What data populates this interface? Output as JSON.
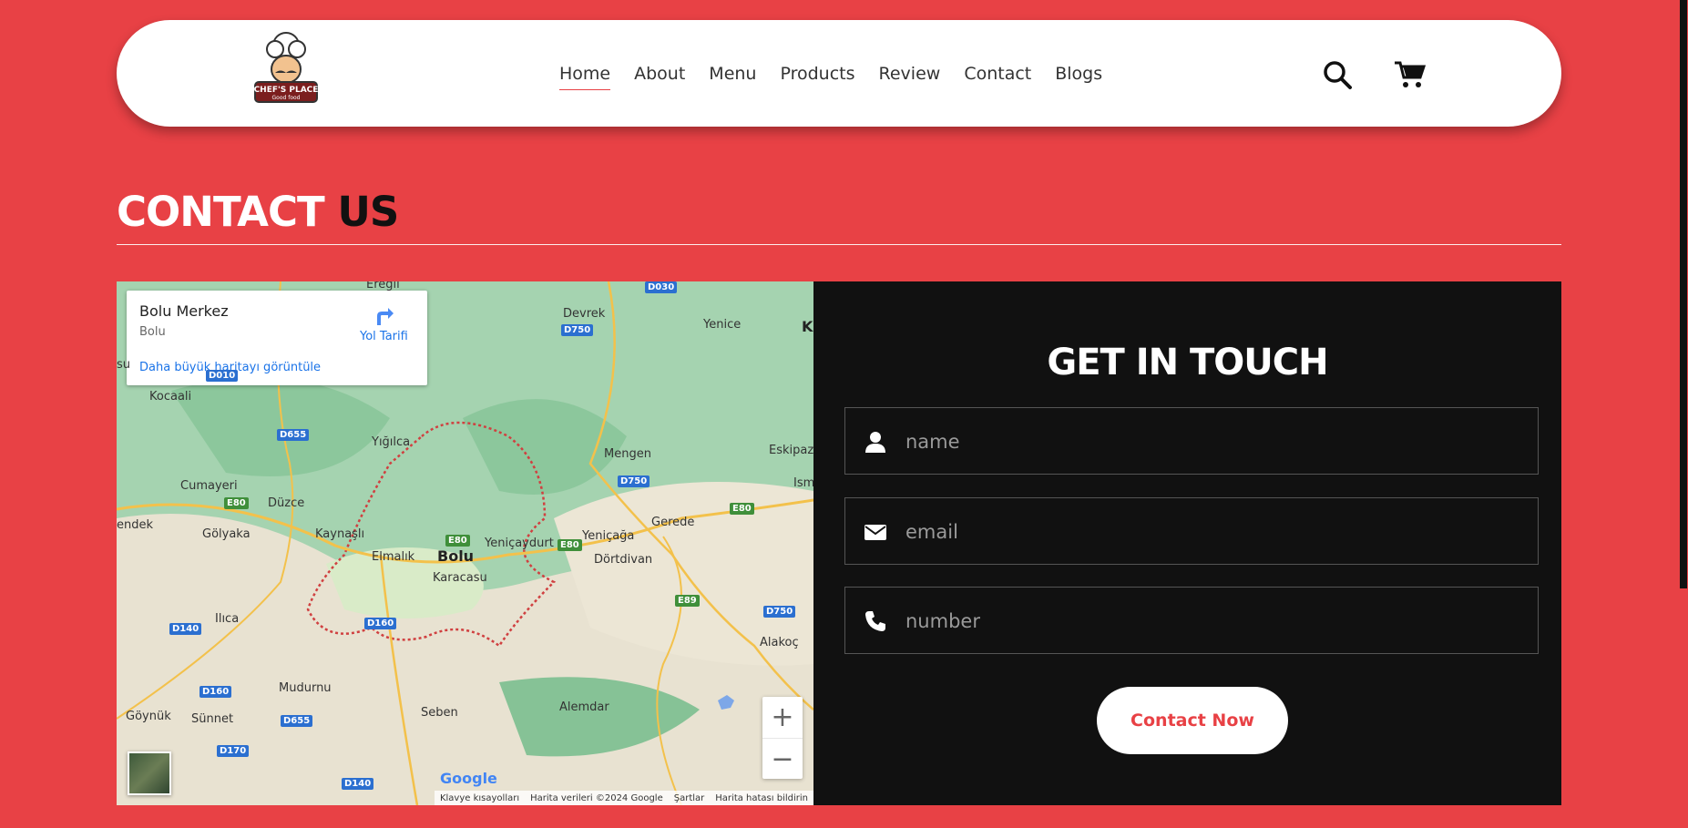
{
  "header": {
    "logo_text": "CHEF'S PLACE",
    "logo_sub": "Good food",
    "nav": [
      {
        "label": "Home",
        "active": true
      },
      {
        "label": "About"
      },
      {
        "label": "Menu"
      },
      {
        "label": "Products"
      },
      {
        "label": "Review"
      },
      {
        "label": "Contact"
      },
      {
        "label": "Blogs"
      }
    ],
    "icons": [
      "search-icon",
      "cart-icon"
    ]
  },
  "section": {
    "title_part1": "CONTACT",
    "title_part2": "US"
  },
  "map": {
    "place_name": "Bolu Merkez",
    "place_region": "Bolu",
    "directions_label": "Yol Tarifi",
    "larger_map_link": "Daha büyük haritayı görüntüle",
    "zoom_in": "+",
    "zoom_out": "−",
    "google_logo": "Google",
    "attribution": [
      "Klavye kısayolları",
      "Harita verileri ©2024 Google",
      "Şartlar",
      "Harita hatası bildirin"
    ],
    "labels": [
      "Ereğli",
      "Devrek",
      "Yenice",
      "Kocaali",
      "Yığılca",
      "Mengen",
      "Eskipazar",
      "Cumayeri",
      "Düzce",
      "Gerede",
      "Gölyaka",
      "Kaynaşlı",
      "Yeniçağa",
      "Elmalık",
      "Bolu",
      "Yeniçaydurt",
      "Dörtdivan",
      "Karacasu",
      "Ilıca",
      "Alakoç",
      "Mudurnu",
      "Göynük",
      "Sünnet",
      "Seben",
      "Alemdar",
      "endek",
      "su",
      "K",
      "Ism"
    ],
    "roads": [
      "D030",
      "D750",
      "D010",
      "D655",
      "E80",
      "E80",
      "D750",
      "E80",
      "E80",
      "E89",
      "D750",
      "D160",
      "D140",
      "D160",
      "D655",
      "D170",
      "D140"
    ]
  },
  "contact_form": {
    "title": "GET IN TOUCH",
    "fields": [
      {
        "placeholder": "name",
        "icon": "user-icon"
      },
      {
        "placeholder": "email",
        "icon": "envelope-icon"
      },
      {
        "placeholder": "number",
        "icon": "phone-icon"
      }
    ],
    "submit_label": "Contact Now"
  },
  "colors": {
    "accent": "#e84145",
    "dark": "#111111",
    "white": "#ffffff"
  }
}
